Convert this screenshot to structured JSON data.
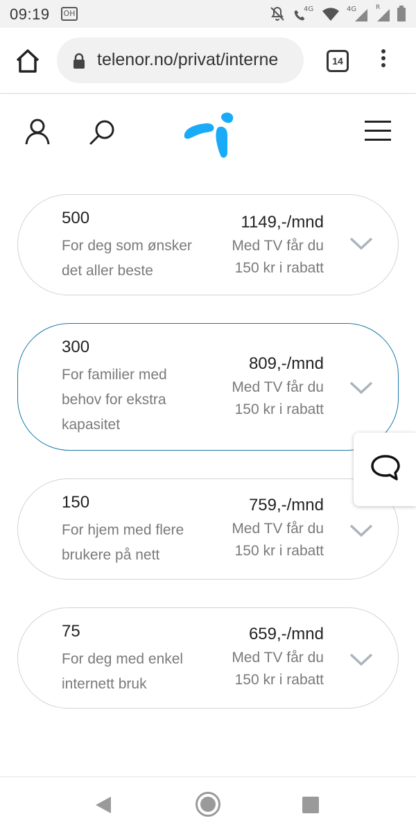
{
  "status_bar": {
    "time": "09:19",
    "app_icon_text": "OH",
    "net_label_1": "4G",
    "net_label_2": "4G",
    "roaming_label": "R",
    "icons": [
      "silent-icon",
      "call-icon",
      "wifi-icon",
      "signal-icon",
      "battery-icon"
    ]
  },
  "browser": {
    "url": "telenor.no/privat/interne",
    "tab_count": "14",
    "icons": [
      "home-icon",
      "lock-icon",
      "tabs-icon",
      "menu-icon"
    ]
  },
  "site_header": {
    "icons": [
      "user-icon",
      "search-icon",
      "telenor-logo-icon",
      "menu-icon"
    ]
  },
  "plans": [
    {
      "speed": "500",
      "description": "For deg som ønsker det aller beste",
      "price": "1149,-/mnd",
      "discount": "Med TV får du 150 kr i rabatt",
      "selected": false
    },
    {
      "speed": "300",
      "description": "For familier med behov for ekstra kapasitet",
      "price": "809,-/mnd",
      "discount": "Med TV får du 150 kr i rabatt",
      "selected": true
    },
    {
      "speed": "150",
      "description": "For hjem med flere brukere på nett",
      "price": "759,-/mnd",
      "discount": "Med TV får du 150 kr i rabatt",
      "selected": false
    },
    {
      "speed": "75",
      "description": "For deg med enkel internett bruk",
      "price": "659,-/mnd",
      "discount": "Med TV får du 150 kr i rabatt",
      "selected": false
    }
  ],
  "colors": {
    "brand_blue": "#19aaf8",
    "selected_border": "#1878a8",
    "muted_text": "#7a7a7a"
  }
}
